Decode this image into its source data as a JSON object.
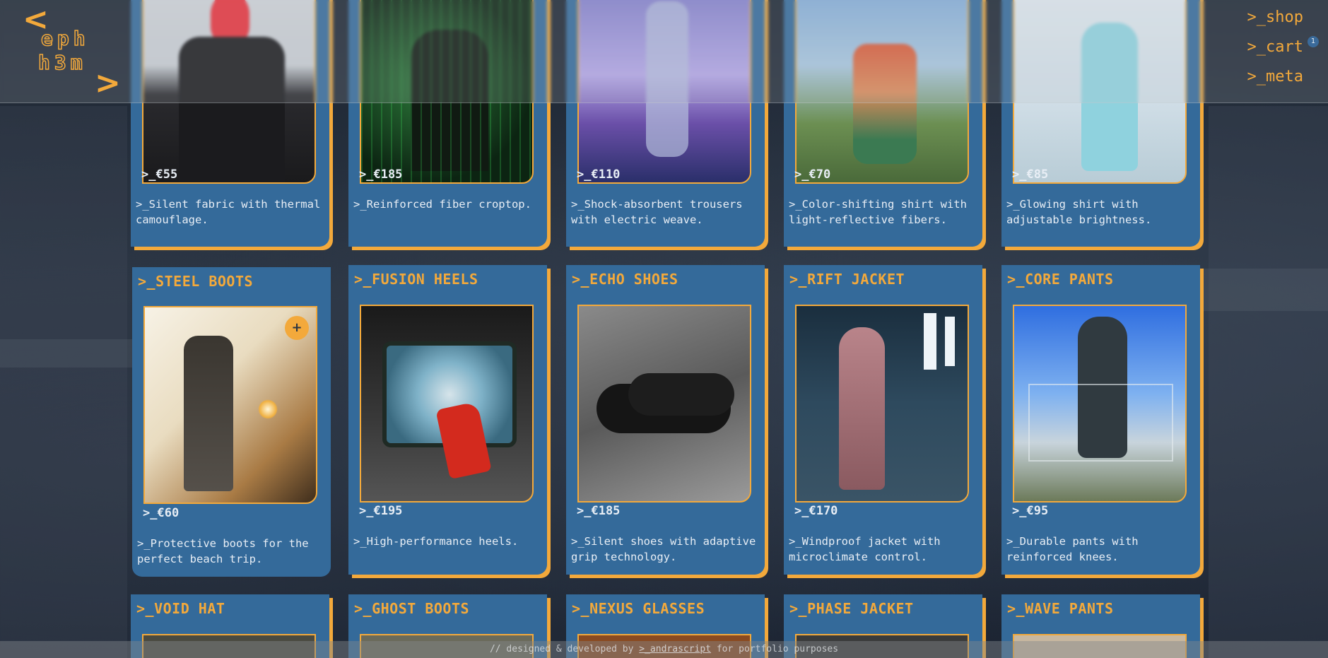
{
  "header": {
    "logo_line1": "eph",
    "logo_line2": "h3m",
    "logo_left": "<",
    "logo_right": ">",
    "nav": [
      {
        "label": ">_shop"
      },
      {
        "label": ">_cart",
        "badge": "1"
      },
      {
        "label": ">_meta"
      }
    ]
  },
  "products_row1": [
    {
      "price": ">_€55",
      "desc": ">_Silent fabric with thermal camouflage."
    },
    {
      "price": ">_€185",
      "desc": ">_Reinforced fiber croptop."
    },
    {
      "price": ">_€110",
      "desc": ">_Shock-absorbent trousers with electric weave."
    },
    {
      "price": ">_€70",
      "desc": ">_Color-shifting shirt with light-reflective fibers."
    },
    {
      "price": ">_€85",
      "desc": ">_Glowing shirt with adjustable brightness."
    }
  ],
  "products_row2": [
    {
      "title": ">_STEEL BOOTS",
      "price": ">_€60",
      "desc": ">_Protective boots for the perfect beach trip.",
      "add_label": "+"
    },
    {
      "title": ">_FUSION HEELS",
      "price": ">_€195",
      "desc": ">_High-performance heels."
    },
    {
      "title": ">_ECHO SHOES",
      "price": ">_€185",
      "desc": ">_Silent shoes with adaptive grip technology."
    },
    {
      "title": ">_RIFT JACKET",
      "price": ">_€170",
      "desc": ">_Windproof jacket with microclimate control."
    },
    {
      "title": ">_CORE PANTS",
      "price": ">_€95",
      "desc": ">_Durable pants with reinforced knees."
    }
  ],
  "products_row3": [
    {
      "title": ">_VOID HAT"
    },
    {
      "title": ">_GHOST BOOTS"
    },
    {
      "title": ">_NEXUS GLASSES"
    },
    {
      "title": ">_PHASE JACKET"
    },
    {
      "title": ">_WAVE PANTS"
    }
  ],
  "footer": {
    "prefix": "// designed & developed by ",
    "link": ">_andrascript",
    "suffix": " for portfolio purposes"
  },
  "colors": {
    "accent": "#f3a93b",
    "card": "#346a9a",
    "text": "#e8eef5"
  }
}
